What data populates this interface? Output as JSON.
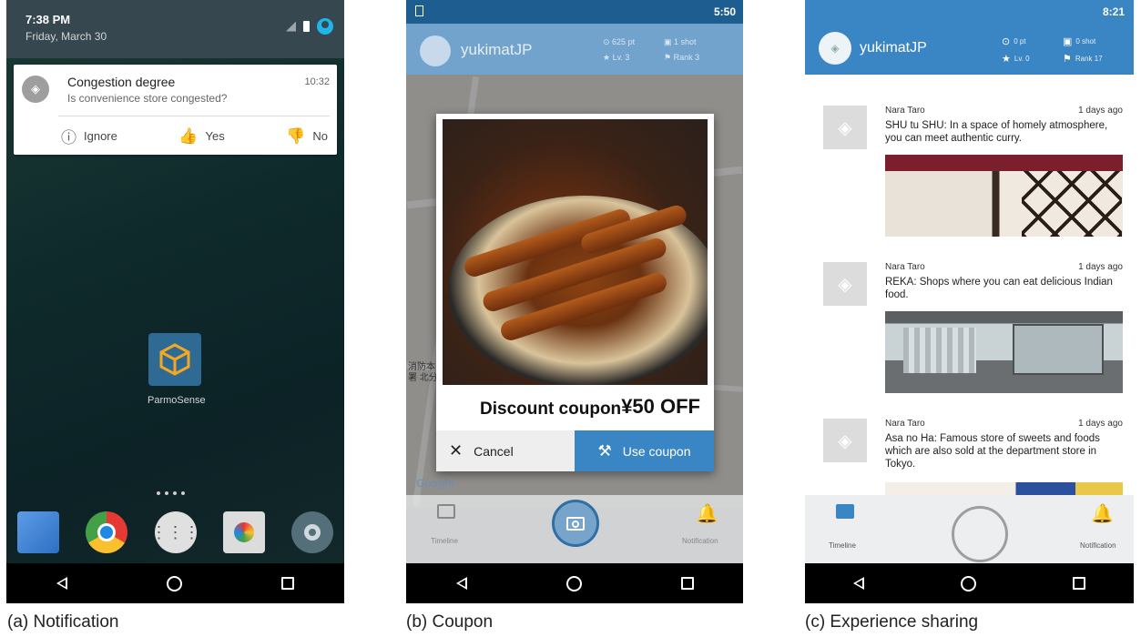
{
  "panel_a": {
    "status": {
      "time": "7:38 PM",
      "date": "Friday, March 30"
    },
    "notification": {
      "title": "Congestion degree",
      "text": "Is convenience store congested?",
      "time": "10:32",
      "actions": [
        {
          "label": "Ignore",
          "icon": "help-circle-icon"
        },
        {
          "label": "Yes",
          "icon": "thumbs-up-icon"
        },
        {
          "label": "No",
          "icon": "thumbs-down-icon"
        }
      ]
    },
    "app": {
      "label": "ParmoSense"
    },
    "caption": "(a)  Notification"
  },
  "panel_b": {
    "status": {
      "time": "5:50"
    },
    "user": {
      "name": "yukimatJP",
      "points": "625 pt",
      "shots": "1 shot",
      "level": "Lv. 3",
      "rank": "Rank 3"
    },
    "map_text": {
      "brand": "Google",
      "label": "消防本\n署 北分"
    },
    "coupon": {
      "title": "Discount coupon",
      "amount": "¥50 OFF",
      "cancel": "Cancel",
      "use": "Use coupon"
    },
    "tabs": {
      "timeline": "Timeline",
      "notification": "Notification"
    },
    "caption": "(b)  Coupon"
  },
  "panel_c": {
    "status": {
      "time": "8:21"
    },
    "user": {
      "name": "yukimatJP",
      "points": "0 pt",
      "shots": "0 shot",
      "level": "Lv. 0",
      "rank": "Rank 17"
    },
    "posts": [
      {
        "author": "Nara Taro",
        "time": "1 days ago",
        "text": "SHU tu SHU: In a space of homely atmosphere, you can meet authentic curry."
      },
      {
        "author": "Nara Taro",
        "time": "1 days ago",
        "text": "REKA: Shops where you can eat delicious Indian food."
      },
      {
        "author": "Nara Taro",
        "time": "1 days ago",
        "text": "Asa no Ha: Famous store of sweets and foods which are also sold at the department store in Tokyo."
      }
    ],
    "tabs": {
      "timeline": "Timeline",
      "notification": "Notification"
    },
    "caption": "(c)  Experience sharing"
  },
  "colors": {
    "accent": "#3a85c4",
    "status_dark": "#1e5d8f",
    "notification_shade": "#37474f"
  }
}
